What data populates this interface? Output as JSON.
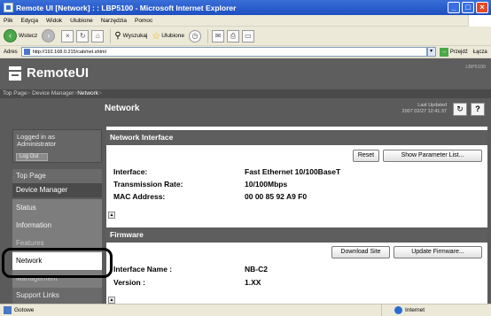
{
  "window": {
    "title": "Remote UI [Network] : : LBP5100 - Microsoft Internet Explorer"
  },
  "menubar": [
    "Plik",
    "Edycja",
    "Widok",
    "Ulubione",
    "Narzędzia",
    "Pomoc"
  ],
  "toolbar": {
    "back": "Wstecz",
    "search": "Wyszukaj",
    "favorites": "Ulubione"
  },
  "address": {
    "label": "Adres",
    "url": "http://192.168.0.215/cab/net.shtml",
    "go": "Przejdź",
    "links": "Łącza"
  },
  "banner": {
    "logo": "RemoteUI",
    "model": "LBP5100"
  },
  "breadcrumb": {
    "top": "Top Page",
    "dm": "Device Manager",
    "current": "Network"
  },
  "sidebar": {
    "login_line1": "Logged in as",
    "login_line2": "Administrator",
    "logout": "Log Out",
    "items": {
      "top": "Top Page",
      "device_manager": "Device Manager",
      "status": "Status",
      "information": "Information",
      "features": "Features",
      "network": "Network",
      "management": "Management",
      "support": "Support Links"
    }
  },
  "main": {
    "title": "Network",
    "last_updated_label": "Last Updated",
    "last_updated_value": "2007 02/27 12:41:37",
    "network_interface": {
      "header": "Network Interface",
      "reset": "Reset",
      "show_params": "Show Parameter List...",
      "rows": [
        {
          "label": "Interface:",
          "value": "Fast Ethernet 10/100BaseT"
        },
        {
          "label": "Transmission Rate:",
          "value": "10/100Mbps"
        },
        {
          "label": "MAC Address:",
          "value": "00 00 85 92 A9 F0"
        }
      ]
    },
    "firmware": {
      "header": "Firmware",
      "download": "Download Site",
      "update": "Update Firmware...",
      "rows": [
        {
          "label": "Interface Name :",
          "value": "NB-C2"
        },
        {
          "label": "Version :",
          "value": "1.XX"
        }
      ]
    }
  },
  "statusbar": {
    "done": "Gotowe",
    "zone": "Internet"
  }
}
